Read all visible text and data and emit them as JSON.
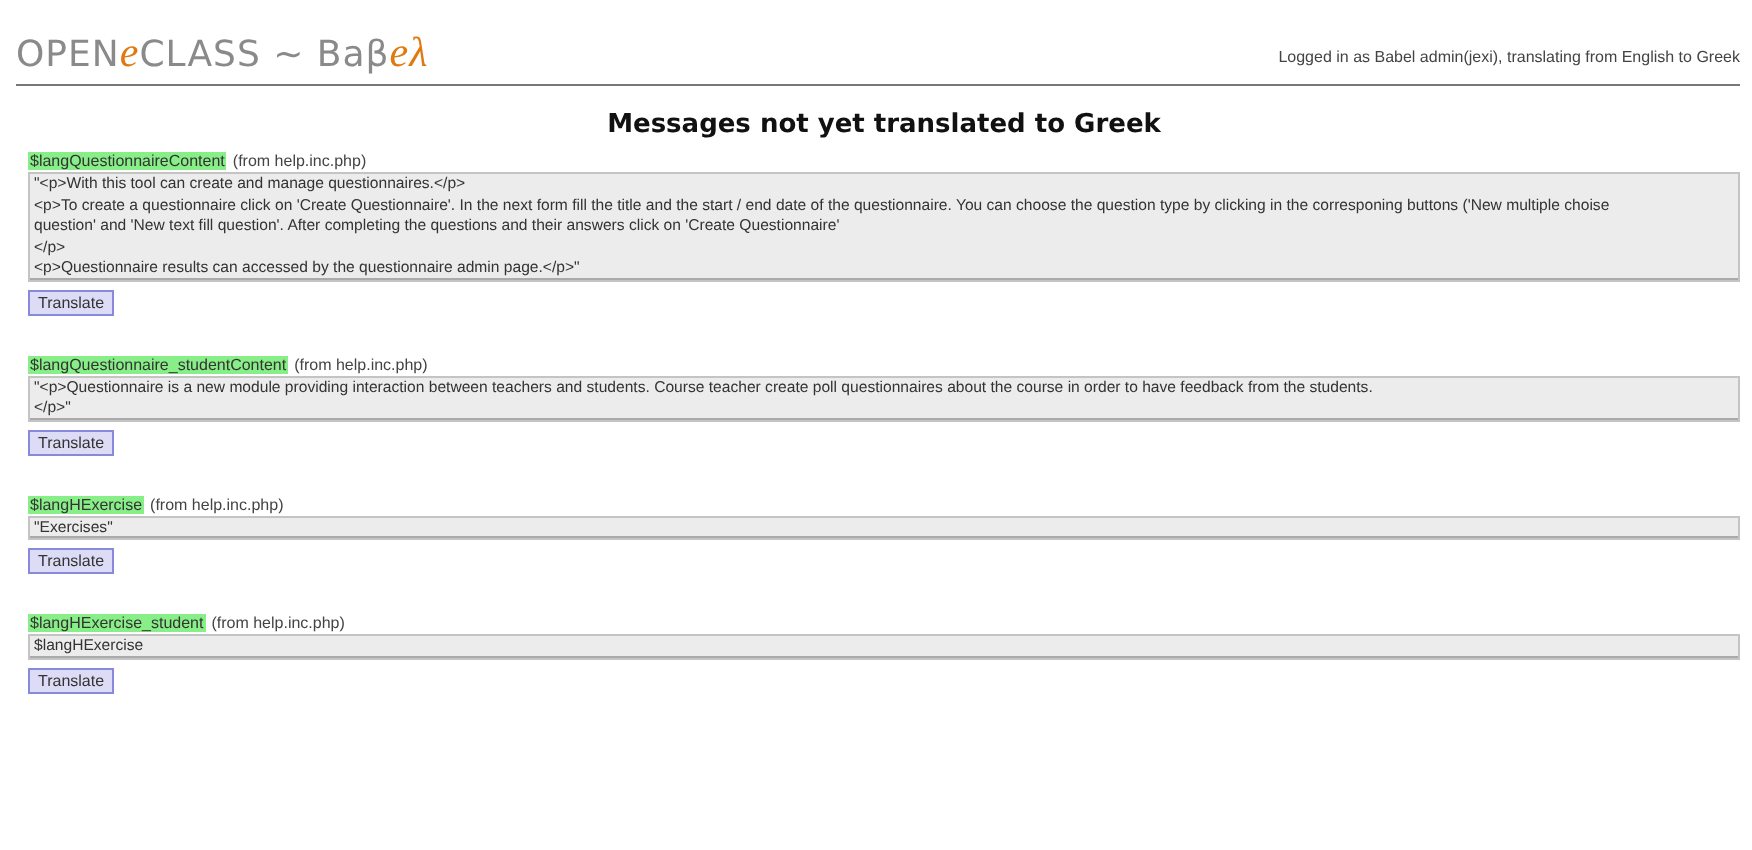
{
  "logo": [
    {
      "text": "OPEN",
      "accent": false
    },
    {
      "text": "e",
      "accent": true
    },
    {
      "text": "CLASS ~ Baβ",
      "accent": false
    },
    {
      "text": "eλ",
      "accent": true
    }
  ],
  "login_status": "Logged in as Babel admin(jexi), translating from English to Greek",
  "heading": "Messages not yet translated to Greek",
  "messages": [
    {
      "key": "$langQuestionnaireContent",
      "source": "(from help.inc.php)",
      "value": "\"<p>With this tool can create and manage questionnaires.</p>\n<p>To create a questionnaire click on 'Create Questionnaire'. In the next form fill the title and the start / end date of the questionnaire. You can choose the question type by clicking in the corresponing buttons ('New multiple choise question' and 'New text fill question'. After completing the questions and their answers click on 'Create Questionnaire'\n</p>\n<p>Questionnaire results can accessed by the questionnaire admin page.</p>\"",
      "button": "Translate"
    },
    {
      "key": "$langQuestionnaire_studentContent",
      "source": "(from help.inc.php)",
      "value": "\"<p>Questionnaire is a new module providing interaction between teachers and students. Course teacher create poll questionnaires about the course in order to have feedback from the students.\n</p>\"",
      "button": "Translate"
    },
    {
      "key": "$langHExercise",
      "source": "(from help.inc.php)",
      "value": "\"Exercises\"",
      "button": "Translate"
    },
    {
      "key": "$langHExercise_student",
      "source": "(from help.inc.php)",
      "value": "$langHExercise",
      "button": "Translate"
    }
  ]
}
